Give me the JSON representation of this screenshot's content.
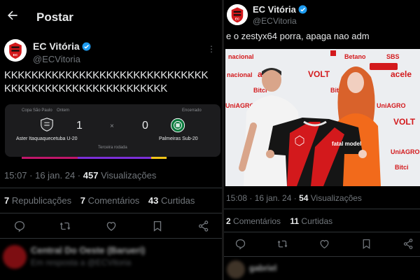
{
  "left": {
    "header": {
      "title": "Postar"
    },
    "author": {
      "name": "EC Vitória",
      "handle": "@ECVitoria"
    },
    "tweet_lines": [
      "KKKKKKKKKKKKKKKKKKKKKKKKKKKKKK",
      "KKKKKKKKKKKKKKKKKKKKKKKK"
    ],
    "match_card": {
      "competition": "Copa São Paulo",
      "when": "Ontem",
      "status": "Encerrado",
      "home_team": "Aster Itaquaquecetuba U-20",
      "home_score": "1",
      "separator": "×",
      "away_score": "0",
      "away_team": "Palmeiras Sub-20",
      "round": "Terceira rodada"
    },
    "meta": {
      "time_date": "15:07 · 16 jan. 24 · ",
      "views_count": "457",
      "views_label": " Visualizações"
    },
    "stats": [
      {
        "count": "7",
        "label": " Republicações"
      },
      {
        "count": "7",
        "label": " Comentários"
      },
      {
        "count": "43",
        "label": " Curtidas"
      }
    ],
    "next_post": {
      "name": "Central Do Oeste (Barueri)",
      "sub": "Em resposta a @ECVitoria"
    }
  },
  "right": {
    "author": {
      "name": "EC Vitória",
      "handle": "@ECVitoria"
    },
    "tweet_text": "e o zestyx64 porra, apaga nao adm",
    "photo_logos": [
      "Betano",
      "SBS",
      "VOLT",
      "nacional",
      "acele",
      "Bitci",
      "UniAGRO",
      "fatal model"
    ],
    "meta": {
      "time_date": "15:08 · 16 jan. 24 · ",
      "views_count": "54",
      "views_label": " Visualizações"
    },
    "stats": [
      {
        "count": "2",
        "label": " Comentários"
      },
      {
        "count": "11",
        "label": " Curtidas"
      }
    ],
    "next_post": {
      "name": "gabriel"
    }
  },
  "colors": {
    "background": "#000000",
    "text": "#e7e9ea",
    "muted": "#71767b",
    "verified": "#1d9bf0",
    "vitoria_red": "#d3191c"
  },
  "icons": [
    "back-arrow-icon",
    "verified-icon",
    "more-dots-icon",
    "reply-icon",
    "repost-icon",
    "like-icon",
    "bookmark-icon",
    "share-icon"
  ]
}
